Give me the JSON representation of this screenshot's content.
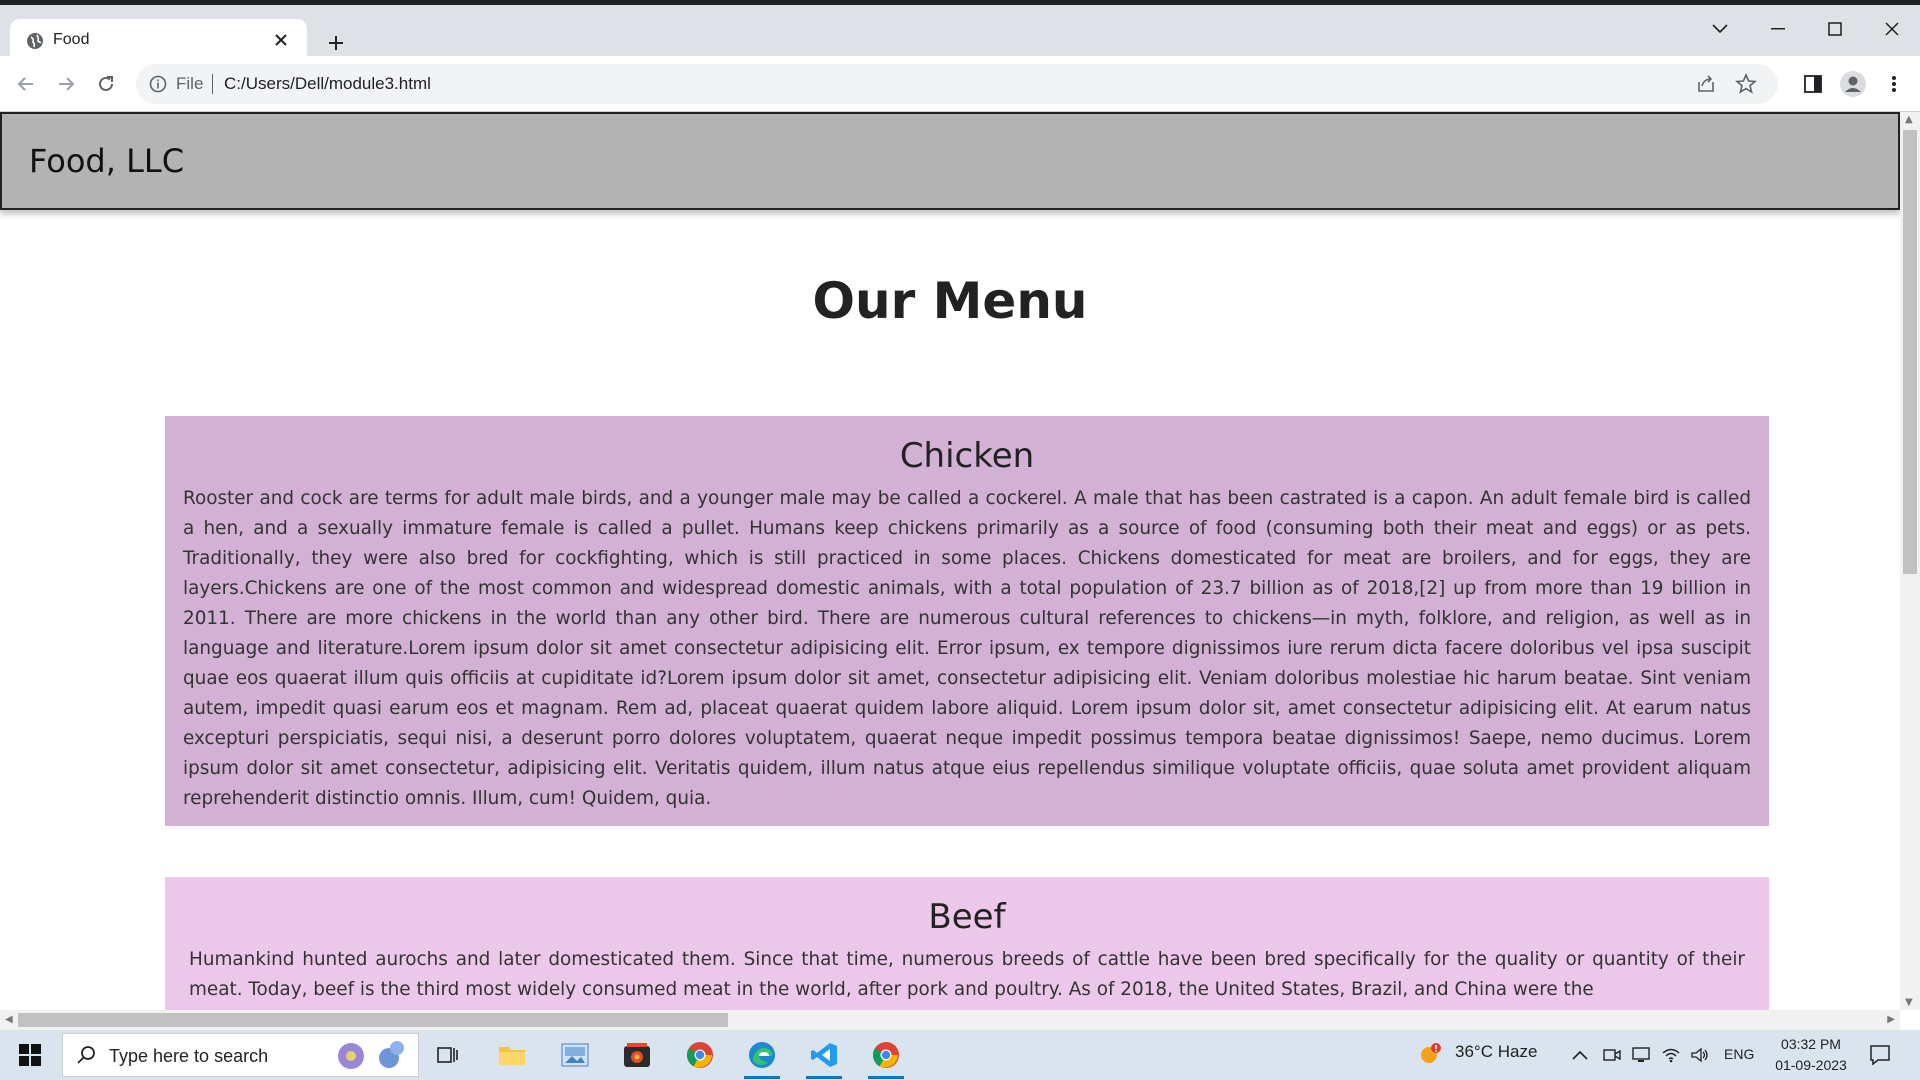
{
  "browser": {
    "tab_title": "Food",
    "address_scheme": "File",
    "address_url": "C:/Users/Dell/module3.html"
  },
  "page": {
    "brand": "Food, LLC",
    "menu_title": "Our Menu",
    "sections": [
      {
        "heading": "Chicken",
        "text": "Rooster and cock are terms for adult male birds, and a younger male may be called a cockerel. A male that has been castrated is a capon. An adult female bird is called a hen, and a sexually immature female is called a pullet. Humans keep chickens primarily as a source of food (consuming both their meat and eggs) or as pets. Traditionally, they were also bred for cockfighting, which is still practiced in some places. Chickens domesticated for meat are broilers, and for eggs, they are layers.Chickens are one of the most common and widespread domestic animals, with a total population of 23.7 billion as of 2018,[2] up from more than 19 billion in 2011. There are more chickens in the world than any other bird. There are numerous cultural references to chickens—in myth, folklore, and religion, as well as in language and literature.Lorem ipsum dolor sit amet consectetur adipisicing elit. Error ipsum, ex tempore dignissimos iure rerum dicta facere doloribus vel ipsa suscipit quae eos quaerat illum quis officiis at cupiditate id?Lorem ipsum dolor sit amet, consectetur adipisicing elit. Veniam doloribus molestiae hic harum beatae. Sint veniam autem, impedit quasi earum eos et magnam. Rem ad, placeat quaerat quidem labore aliquid. Lorem ipsum dolor sit, amet consectetur adipisicing elit. At earum natus excepturi perspiciatis, sequi nisi, a deserunt porro dolores voluptatem, quaerat neque impedit possimus tempora beatae dignissimos! Saepe, nemo ducimus. Lorem ipsum dolor sit amet consectetur, adipisicing elit. Veritatis quidem, illum natus atque eius repellendus similique voluptate officiis, quae soluta amet provident aliquam reprehenderit distinctio omnis. Illum, cum! Quidem, quia."
      },
      {
        "heading": "Beef",
        "text": "Humankind hunted aurochs and later domesticated them. Since that time, numerous breeds of cattle have been bred specifically for the quality or quantity of their meat. Today, beef is the third most widely consumed meat in the world, after pork and poultry. As of 2018, the United States, Brazil, and China were the"
      }
    ],
    "colors": {
      "header_bg": "#b3b3b3",
      "chicken_bg": "#d3b1d4",
      "beef_bg": "#ebc8e9"
    }
  },
  "taskbar": {
    "search_placeholder": "Type here to search",
    "weather": "36°C  Haze",
    "language": "ENG",
    "time": "03:32 PM",
    "date": "01-09-2023",
    "apps": [
      "task-view-icon",
      "file-explorer-icon",
      "photos-icon",
      "media-app-icon",
      "chrome-icon",
      "edge-icon",
      "vscode-icon",
      "chrome-active-icon"
    ]
  }
}
